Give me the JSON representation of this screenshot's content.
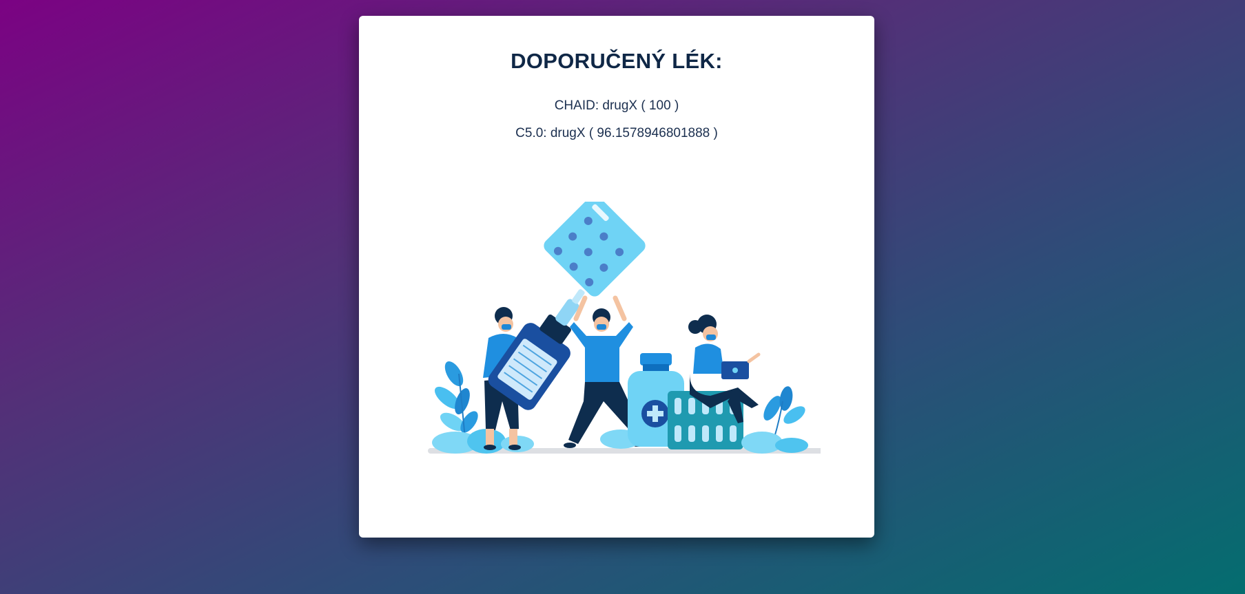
{
  "card": {
    "title": "DOPORUČENÝ LÉK:",
    "results": [
      {
        "text": "CHAID: drugX ( 100 )"
      },
      {
        "text": "C5.0: drugX ( 96.1578946801888 )"
      }
    ]
  },
  "illustration": {
    "icon": "pharmacy-illustration"
  },
  "colors": {
    "background_start": "#7b0283",
    "background_end": "#046d6f",
    "title": "#0f2746",
    "accent_blue": "#1f9ae0",
    "accent_light": "#6fd3f5",
    "navy": "#0e2d4e"
  }
}
